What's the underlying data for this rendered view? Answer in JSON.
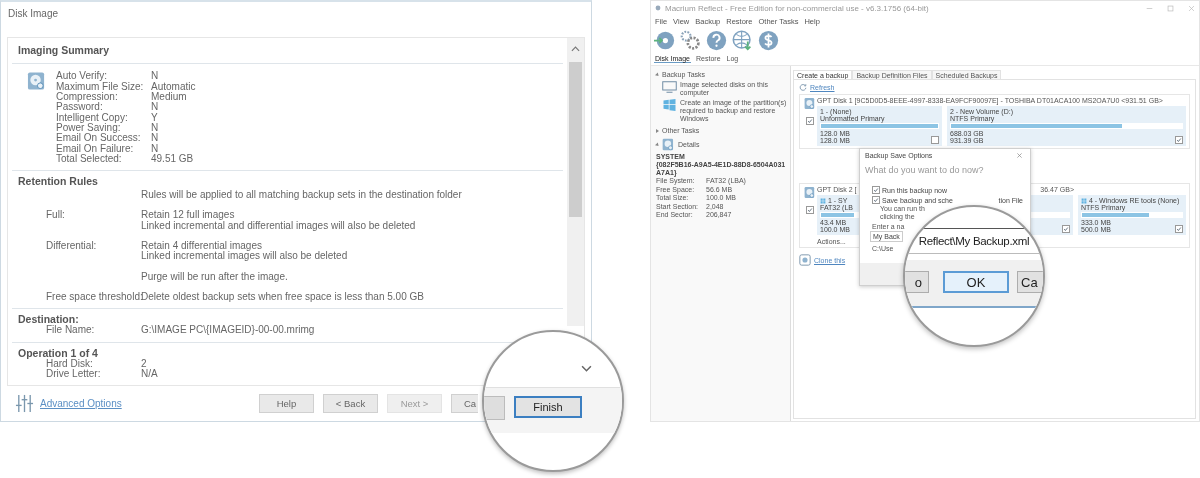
{
  "left_window": {
    "title": "Disk Image",
    "sections": [
      {
        "kind": "summary",
        "heading": "Imaging Summary",
        "rows": [
          {
            "label": "Auto Verify:",
            "lines": [
              "N"
            ]
          },
          {
            "label": "Maximum File Size:",
            "lines": [
              "Automatic"
            ]
          },
          {
            "label": "Compression:",
            "lines": [
              "Medium"
            ]
          },
          {
            "label": "Password:",
            "lines": [
              "N"
            ]
          },
          {
            "label": "Intelligent Copy:",
            "lines": [
              "Y"
            ]
          },
          {
            "label": "Power Saving:",
            "lines": [
              "N"
            ]
          },
          {
            "label": "Email On Success:",
            "lines": [
              "N"
            ]
          },
          {
            "label": "Email On Failure:",
            "lines": [
              "N"
            ]
          },
          {
            "label": "Total Selected:",
            "lines": [
              "49.51 GB"
            ]
          }
        ]
      },
      {
        "kind": "rules",
        "heading": "Retention Rules",
        "rows": [
          {
            "lines": [
              "Rules will be applied to all matching backup sets in the destination folder"
            ]
          },
          {
            "label": "Full:",
            "lines": [
              "Retain 12 full images",
              "Linked incremental and differential images will also be deleted"
            ]
          },
          {
            "label": "Differential:",
            "lines": [
              "Retain 4 differential images",
              "Linked incremental images will also be deleted"
            ]
          },
          {
            "lines": [
              "Purge will be run after the image."
            ]
          },
          {
            "label": "Free space threshold:",
            "lines": [
              "Delete oldest backup sets when free space is less than 5.00 GB"
            ]
          }
        ]
      },
      {
        "kind": "detail",
        "heading": "Destination:",
        "rows": [
          {
            "label": "File Name:",
            "lines": [
              "G:\\IMAGE PC\\{IMAGEID}-00-00.mrimg"
            ]
          }
        ]
      },
      {
        "kind": "detail",
        "heading": "Operation 1 of 4",
        "rows": [
          {
            "label": "Hard Disk:",
            "lines": [
              "2"
            ]
          },
          {
            "label": "Drive Letter:",
            "lines": [
              "N/A"
            ]
          }
        ]
      }
    ],
    "advanced_options": "Advanced Options",
    "buttons": [
      {
        "label": "Help",
        "disabled": false
      },
      {
        "label": "< Back",
        "disabled": false
      },
      {
        "label": "Next >",
        "disabled": true
      },
      {
        "label": "Ca",
        "disabled": false
      }
    ],
    "magnifier": {
      "button": "Finish"
    }
  },
  "right_window": {
    "title": "Macrium Reflect - Free Edition for non-commercial use - v6.3.1756 (64-bit)",
    "menu": [
      "File",
      "View",
      "Backup",
      "Restore",
      "Other Tasks",
      "Help"
    ],
    "toolbar_tabs": [
      {
        "label": "Disk Image",
        "selected": true
      },
      {
        "label": "Restore",
        "selected": false
      },
      {
        "label": "Log",
        "selected": false
      }
    ],
    "sidebar": {
      "groups": [
        {
          "label": "Backup Tasks",
          "expanded": true,
          "items": [
            {
              "kind": "monitor",
              "text": "Image selected disks on this computer"
            },
            {
              "kind": "tiles",
              "text": "Create an image of the partition(s) required to backup and restore Windows"
            }
          ]
        },
        {
          "label": "Other Tasks",
          "expanded": false
        },
        {
          "label": "Details",
          "expanded": true,
          "details": {
            "name": "SYSTEM",
            "id": "{082F5B16-A9A5-4E1D-88D8-6504A031A7A1}",
            "rows": [
              {
                "label": "File System:",
                "value": "FAT32 (LBA)"
              },
              {
                "label": "Free Space:",
                "value": "56.6 MB"
              },
              {
                "label": "Total Size:",
                "value": "100.0 MB"
              },
              {
                "label": "Start Section:",
                "value": "2,048"
              },
              {
                "label": "End Sector:",
                "value": "206,847"
              }
            ]
          }
        }
      ]
    },
    "content_tabs": [
      {
        "label": "Create a backup",
        "selected": true
      },
      {
        "label": "Backup Definition Files",
        "selected": false
      },
      {
        "label": "Scheduled Backups",
        "selected": false
      }
    ],
    "refresh": "Refresh",
    "disks": [
      {
        "header": "GPT Disk 1 [9C5D0D5-8EEE-4997-8338-EA9FCF90097E] - TOSHIBA DT01ACA100 MS2OA7U0  <931.51 GB>",
        "checked": true,
        "partitions": [
          {
            "kind": "plain",
            "name": "1 - (None)",
            "type": "Unformatted Primary",
            "level": 1,
            "used": "128.0 MB",
            "size": "128.0 MB",
            "checked": false
          },
          {
            "kind": "plain",
            "name": "2 - New Volume (D:)",
            "type": "NTFS Primary",
            "level": 0.74,
            "used": "688.03 GB",
            "size": "931.39 GB",
            "checked": true
          }
        ]
      },
      {
        "header": "GPT Disk 2 [",
        "header_end": "36.47 GB>",
        "checked": true,
        "actions": "Actions...",
        "partitions": [
          {
            "kind": "system",
            "name": "1 - SY",
            "type": "FAT32 (LB",
            "level": 0.43,
            "used": "43.4 MB",
            "size": "100.0 MB"
          },
          {
            "kind": "plain",
            "checked": true
          },
          {
            "kind": "system",
            "name": "4 - Windows RE tools (None)",
            "type": "NTFS Primary",
            "level": 0.67,
            "used": "333.0 MB",
            "size": "500.0 MB",
            "checked": true
          }
        ]
      }
    ],
    "clone": "Clone this",
    "dialog": {
      "title": "Backup Save Options",
      "question": "What do you want to do now?",
      "options": [
        {
          "label": "Run this backup now",
          "checked": true
        },
        {
          "label": "Save backup and sche",
          "checked": true
        }
      ],
      "option_tail": "tion File",
      "notes": [
        "You can run th",
        "clicking the"
      ],
      "name_prompt": "Enter a na",
      "name_value": "My Back",
      "path": "C:\\Use"
    },
    "magnifier": {
      "value": "Reflect\\My Backup.xml",
      "buttons": [
        {
          "label": "o",
          "focused": false
        },
        {
          "label": "OK",
          "focused": true
        },
        {
          "label": "Ca",
          "focused": false
        }
      ]
    }
  }
}
